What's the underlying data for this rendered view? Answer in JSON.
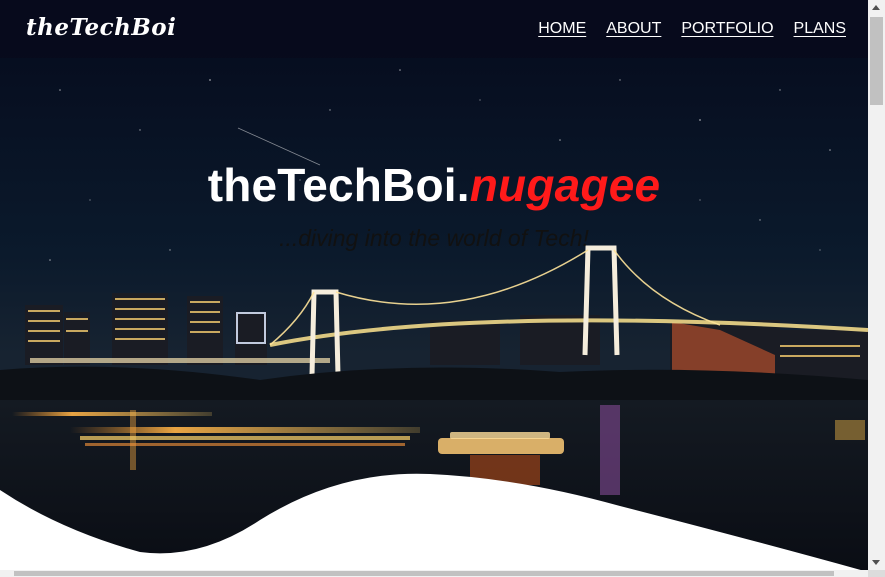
{
  "brand": {
    "logo_text": "theTechBoi"
  },
  "nav": {
    "items": [
      {
        "label": "HOME"
      },
      {
        "label": "ABOUT"
      },
      {
        "label": "PORTFOLIO"
      },
      {
        "label": "PLANS"
      }
    ]
  },
  "hero": {
    "title_main": "theTechBoi.",
    "title_accent": "nugagee",
    "tagline": "...diving into the world of Tech!",
    "background": "night-city-bridge-photo"
  },
  "colors": {
    "accent": "#ff1a1a",
    "navbar": "#080a1c",
    "text_light": "#ffffff"
  }
}
